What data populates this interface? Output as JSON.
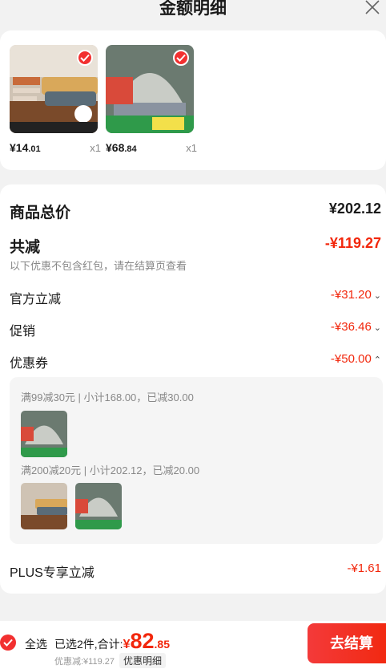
{
  "header": {
    "title": "金额明细"
  },
  "products": [
    {
      "price_int": "¥14",
      "price_dec": ".01",
      "qty": "x1"
    },
    {
      "price_int": "¥68",
      "price_dec": ".84",
      "qty": "x1"
    }
  ],
  "summary": {
    "total_label": "商品总价",
    "total_value": "¥202.12",
    "reduce_label": "共减",
    "reduce_value": "-¥119.27",
    "reduce_hint": "以下优惠不包含红包，请在结算页查看",
    "items": [
      {
        "label": "官方立减",
        "value": "-¥31.20",
        "chevron": "⌄"
      },
      {
        "label": "促销",
        "value": "-¥36.46",
        "chevron": "⌄"
      },
      {
        "label": "优惠券",
        "value": "-¥50.00",
        "chevron": "⌃"
      }
    ],
    "coupons": [
      {
        "text": "满99减30元 | 小计168.00，已减30.00"
      },
      {
        "text": "满200减20元 | 小计202.12，已减20.00"
      }
    ],
    "plus_label": "PLUS专享立减",
    "plus_value": "-¥1.61"
  },
  "bottom": {
    "select_all": "全选",
    "selected_text": "已选2件,合计:",
    "total_symbol": "¥",
    "total_int": "82",
    "total_dec": ".85",
    "discount_text": "优惠减:¥119.27",
    "detail_label": "优惠明细",
    "checkout_label": "去结算"
  },
  "colors": {
    "accent": "#f2270c",
    "background": "#f2f2f2"
  }
}
